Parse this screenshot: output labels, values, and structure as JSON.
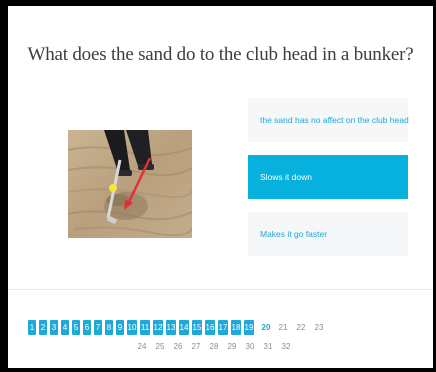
{
  "quiz": {
    "question": "What does the sand do to the club head in a bunker?",
    "answers": [
      {
        "label": "the sand has no affect on the club head",
        "selected": false
      },
      {
        "label": "Slows it down",
        "selected": true
      },
      {
        "label": "Makes it go faster",
        "selected": false
      }
    ],
    "image": {
      "icon": "golf-bunker-photo",
      "arrow_color": "#e0303a"
    }
  },
  "pagination": {
    "completed": [
      "1",
      "2",
      "3",
      "4",
      "5",
      "6",
      "7",
      "8",
      "9",
      "10",
      "11",
      "12",
      "13",
      "14",
      "15",
      "16",
      "17",
      "18",
      "19"
    ],
    "current": "20",
    "remaining_row1": [
      "21",
      "22",
      "23"
    ],
    "remaining_row2": [
      "24",
      "25",
      "26",
      "27",
      "28",
      "29",
      "30",
      "31",
      "32"
    ]
  },
  "colors": {
    "accent": "#06b1de",
    "answer_bg": "#f6f7f9",
    "answer_text": "#1aa9d6"
  }
}
